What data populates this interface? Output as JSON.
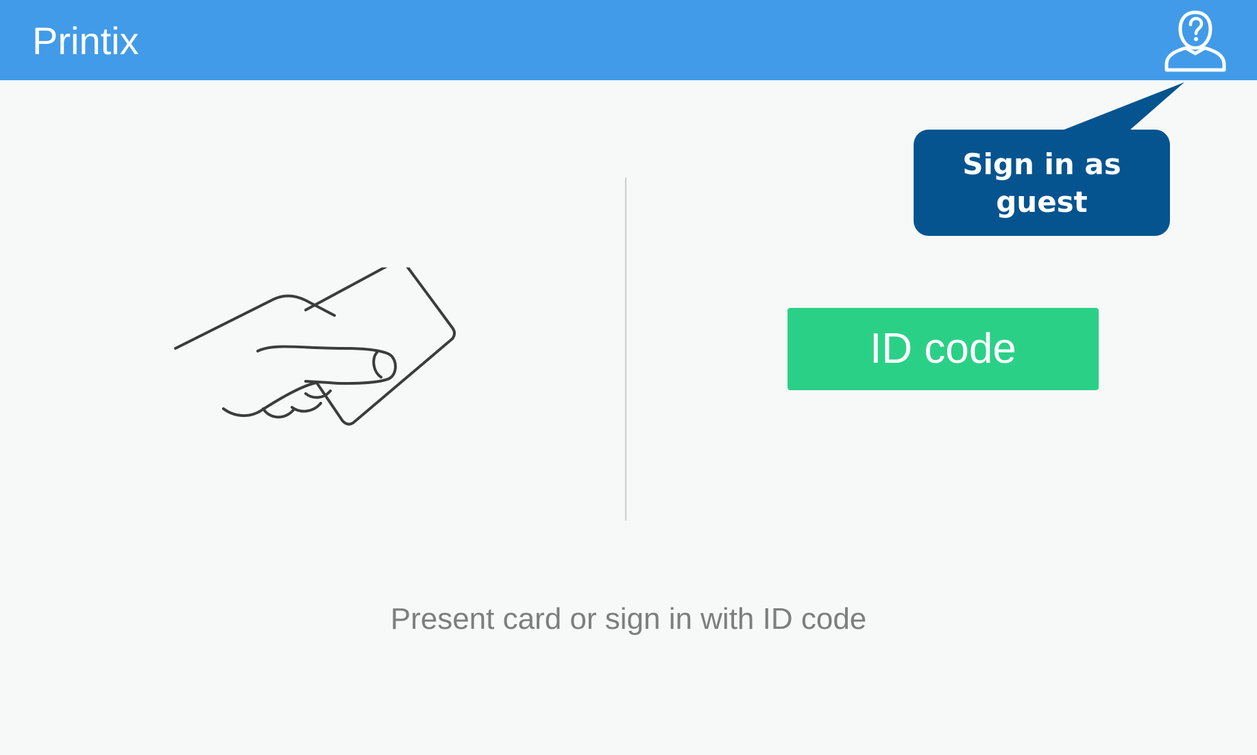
{
  "header": {
    "title": "Printix",
    "guest_icon": "guest-user-question-icon"
  },
  "tooltip": {
    "text": "Sign in as guest"
  },
  "illustration": {
    "icon": "hand-holding-card-icon"
  },
  "id_code_button": {
    "label": "ID code"
  },
  "instruction": {
    "text": "Present card or sign in with ID code"
  },
  "colors": {
    "header": "#429be8",
    "tooltip": "#05548f",
    "button": "#2bd087",
    "background": "#f6f9f7",
    "instruction_text": "#7e7e7e"
  }
}
